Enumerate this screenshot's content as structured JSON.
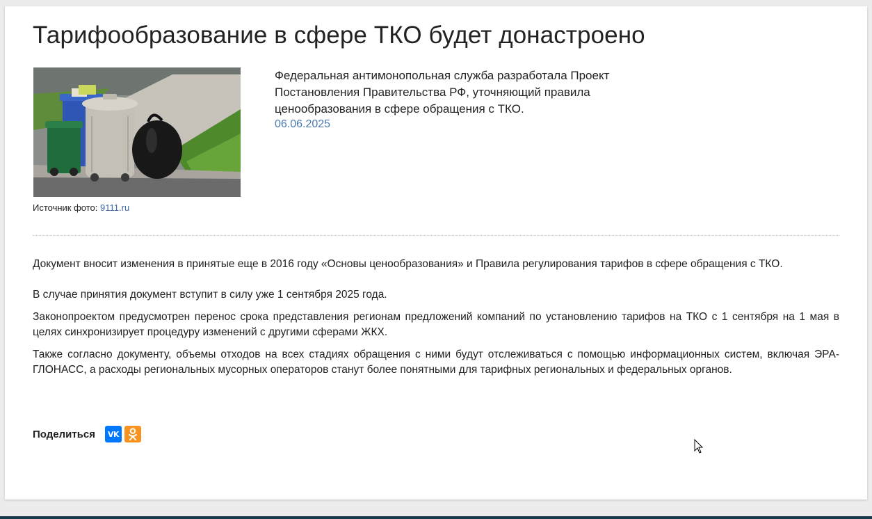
{
  "article": {
    "title": "Тарифообразование в сфере ТКО будет донастроено",
    "lead": "Федеральная антимонопольная служба разработала Проект Постановления Правительства РФ, уточняющий правила ценообразования в сфере обращения с ТКО.",
    "date": "06.06.2025",
    "photo": {
      "caption_prefix": "Источник фото: ",
      "source_link": "9111.ru"
    },
    "paragraphs": [
      "Документ вносит изменения в принятые еще в 2016 году «Основы ценообразования» и Правила регулирования тарифов в сфере обращения с ТКО.",
      "В случае принятия документ вступит в силу уже 1 сентября 2025 года.",
      "Законопроектом предусмотрен перенос срока представления регионам предложений компаний по установлению тарифов на ТКО с 1 сентября на 1 мая в целях синхронизирует процедуру изменений с другими сферами ЖКХ.",
      "Также согласно документу, объемы отходов на всех стадиях обращения с ними будут отслеживаться с помощью информационных систем, включая ЭРА-ГЛОНАСС, а расходы региональных мусорных операторов станут более понятными для тарифных региональных и федеральных органов."
    ]
  },
  "share": {
    "label": "Поделиться",
    "buttons": [
      {
        "name": "vk",
        "icon": "vk-icon",
        "text": "VK",
        "color": "#0077ff"
      },
      {
        "name": "odnoklassniki",
        "icon": "ok-icon",
        "color": "#f7931e"
      }
    ]
  },
  "colors": {
    "link": "#3a6aa7",
    "date": "#4a78b0",
    "bottom_bar": "#173a4a"
  }
}
